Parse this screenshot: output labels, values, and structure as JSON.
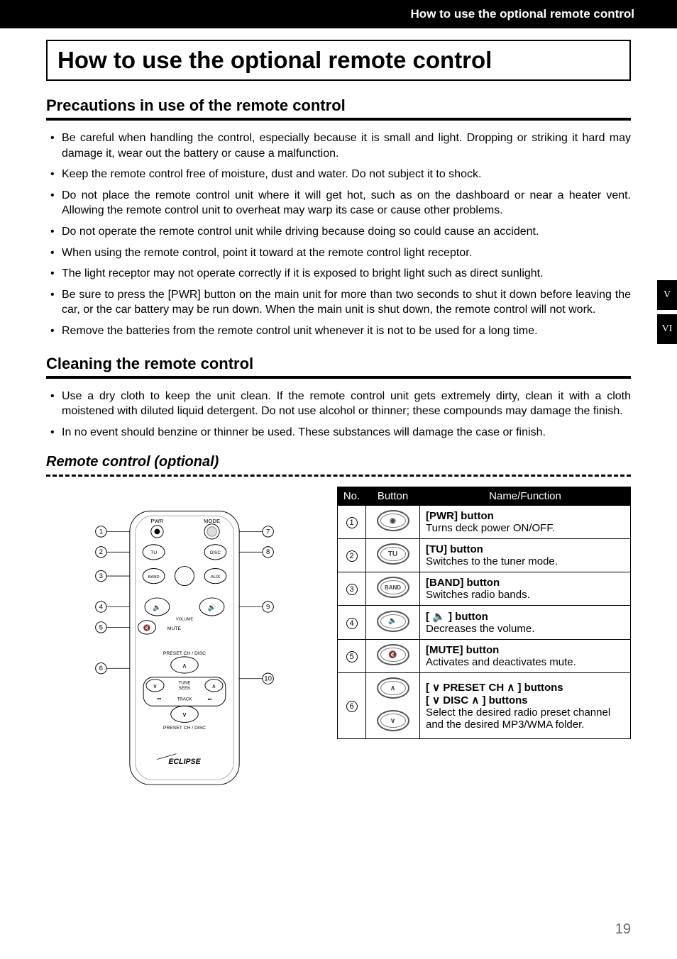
{
  "header": {
    "title": "How to use the optional remote control"
  },
  "page_title": "How to use the optional remote control",
  "sections": {
    "precautions": {
      "heading": "Precautions in use of the remote control",
      "items": [
        "Be careful when handling the control, especially because it is small and light. Dropping or striking it hard may damage it, wear out the battery or cause a malfunction.",
        "Keep the remote control free of moisture, dust and water. Do not subject it to shock.",
        "Do not place the remote control unit where it will get hot, such as on the dashboard or near a heater vent. Allowing the remote control unit to overheat may warp its case or cause other problems.",
        "Do not operate the remote control unit while driving because doing so could cause an accident.",
        "When using the remote control, point it toward at the remote control light receptor.",
        "The light receptor may not operate correctly if it is exposed to bright light such as direct sunlight.",
        "Be sure to press the [PWR] button on the main unit for more than two seconds to shut it down before leaving the car, or the car battery may be run down. When the main unit is shut down, the remote control will not work.",
        "Remove the batteries from the remote control unit whenever it is not to be used for a long time."
      ]
    },
    "cleaning": {
      "heading": "Cleaning the remote control",
      "items": [
        "Use a dry cloth to keep the unit clean. If the remote control unit gets extremely dirty, clean it with a cloth moistened with diluted liquid detergent. Do not use alcohol or thinner; these compounds may damage the finish.",
        "In no event should benzine or thinner be used. These substances will damage the case or finish."
      ]
    },
    "remote": {
      "heading": "Remote control (optional)"
    }
  },
  "diagram_labels": {
    "pwr": "PWR",
    "mode": "MODE",
    "tu": "TU",
    "disc": "DISC",
    "band": "BAND",
    "aux": "AUX",
    "volume": "VOLUME",
    "mute": "MUTE",
    "preset": "PRESET CH / DISC",
    "tune_seek": "TUNE\nSEEK",
    "track": "TRACK",
    "brand": "ECLIPSE",
    "callouts": [
      "1",
      "2",
      "3",
      "4",
      "5",
      "6",
      "7",
      "8",
      "9",
      "10"
    ]
  },
  "table": {
    "headers": {
      "no": "No.",
      "button": "Button",
      "fn": "Name/Function"
    },
    "rows": [
      {
        "no": "1",
        "icon": "◉",
        "name": "[PWR] button",
        "desc": "Turns deck power ON/OFF."
      },
      {
        "no": "2",
        "icon": "TU",
        "name": "[TU] button",
        "desc": "Switches to the tuner mode."
      },
      {
        "no": "3",
        "icon": "BAND",
        "name": "[BAND] button",
        "desc": "Switches radio bands."
      },
      {
        "no": "4",
        "icon": "🔈",
        "name": "[ 🔈 ] button",
        "desc": "Decreases the volume."
      },
      {
        "no": "5",
        "icon": "🔇",
        "name": "[MUTE] button",
        "desc": "Activates and deactivates mute."
      },
      {
        "no": "6",
        "icon_up": "∧",
        "icon_down": "∨",
        "name1": "[ ∨ PRESET CH ∧ ] buttons",
        "name2": "[ ∨ DISC ∧ ] buttons",
        "desc": "Select the desired radio preset channel and the desired MP3/WMA folder."
      }
    ]
  },
  "side_tabs": [
    "V",
    "VI"
  ],
  "page_number": "19"
}
